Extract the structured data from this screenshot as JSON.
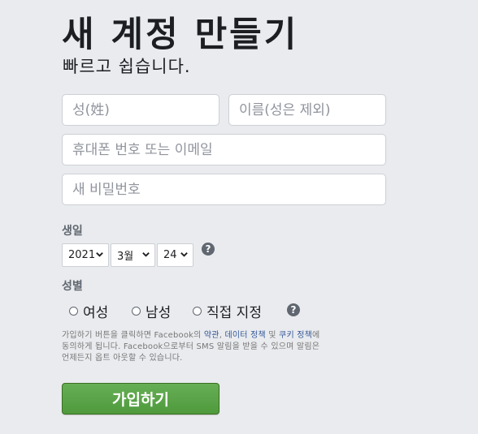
{
  "header": {
    "title": "새 계정 만들기",
    "subtitle": "빠르고 쉽습니다."
  },
  "form": {
    "last_name_placeholder": "성(姓)",
    "first_name_placeholder": "이름(성은 제외)",
    "contact_placeholder": "휴대폰 번호 또는 이메일",
    "password_placeholder": "새 비밀번호"
  },
  "birthday": {
    "label": "생일",
    "year": "2021",
    "month": "3월",
    "day": "24",
    "help": "?"
  },
  "gender": {
    "label": "성별",
    "options": [
      "여성",
      "남성",
      "직접 지정"
    ],
    "help": "?"
  },
  "terms": {
    "part1": "가입하기 버튼을 클릭하면 Facebook의 ",
    "link_terms": "약관",
    "sep1": ", ",
    "link_data": "데이터 정책",
    "sep2": " 및 ",
    "link_cookie": "쿠키 정책",
    "part2": "에 동의하게 됩니다. Facebook으로부터 SMS 알림을 받을 수 있으며 알림은 언제든지 옵트 아웃할 수 있습니다."
  },
  "signup_label": "가입하기",
  "colors": {
    "background": "#e9ebee",
    "signup_green": "#5aa345",
    "link": "#365899"
  }
}
